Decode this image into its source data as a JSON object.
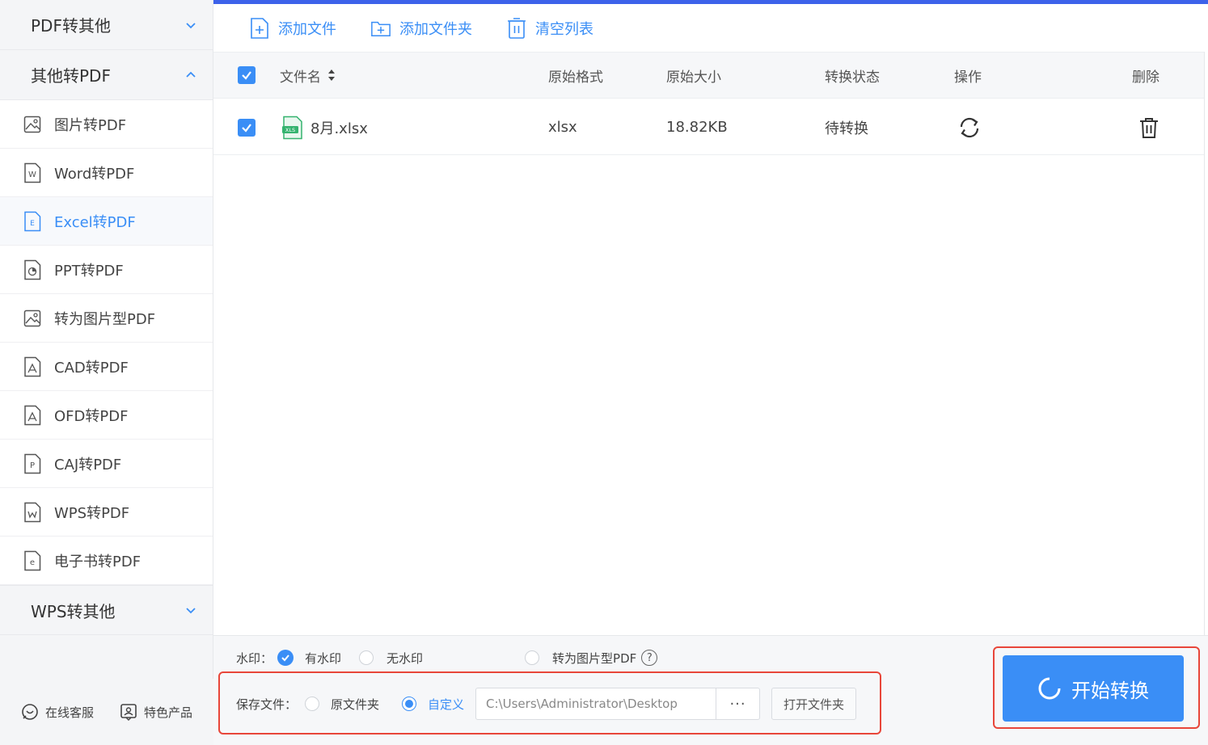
{
  "sidebar": {
    "section_pdf_to_other": "PDF转其他",
    "section_other_to_pdf": "其他转PDF",
    "section_wps_to_other": "WPS转其他",
    "items": [
      {
        "label": "图片转PDF",
        "icon": "image-icon"
      },
      {
        "label": "Word转PDF",
        "icon": "word-doc-icon"
      },
      {
        "label": "Excel转PDF",
        "icon": "excel-doc-icon",
        "active": true
      },
      {
        "label": "PPT转PDF",
        "icon": "ppt-doc-icon"
      },
      {
        "label": "转为图片型PDF",
        "icon": "image-icon"
      },
      {
        "label": "CAD转PDF",
        "icon": "pdf-doc-icon"
      },
      {
        "label": "OFD转PDF",
        "icon": "pdf-doc-icon"
      },
      {
        "label": "CAJ转PDF",
        "icon": "p-doc-icon"
      },
      {
        "label": "WPS转PDF",
        "icon": "wps-doc-icon"
      },
      {
        "label": "电子书转PDF",
        "icon": "ebook-doc-icon"
      }
    ],
    "footer": {
      "online_service": "在线客服",
      "featured_products": "特色产品"
    }
  },
  "toolbar": {
    "add_file": "添加文件",
    "add_folder": "添加文件夹",
    "clear_list": "清空列表"
  },
  "table": {
    "headers": {
      "filename": "文件名",
      "format": "原始格式",
      "size": "原始大小",
      "status": "转换状态",
      "action": "操作",
      "delete": "删除"
    },
    "rows": [
      {
        "filename": "8月.xlsx",
        "format": "xlsx",
        "size": "18.82KB",
        "status": "待转换"
      }
    ]
  },
  "options": {
    "watermark_label": "水印：",
    "with_watermark": "有水印",
    "no_watermark": "无水印",
    "to_image_pdf": "转为图片型PDF",
    "help": "?",
    "save_label": "保存文件：",
    "original_folder": "原文件夹",
    "custom": "自定义",
    "path_value": "C:\\Users\\Administrator\\Desktop",
    "browse": "···",
    "open_folder": "打开文件夹"
  },
  "start_button": "开始转换",
  "colors": {
    "accent": "#3a8ef6",
    "top_line": "#3d62ea",
    "highlight_box": "#e8463a",
    "excel_green": "#35b36f"
  }
}
